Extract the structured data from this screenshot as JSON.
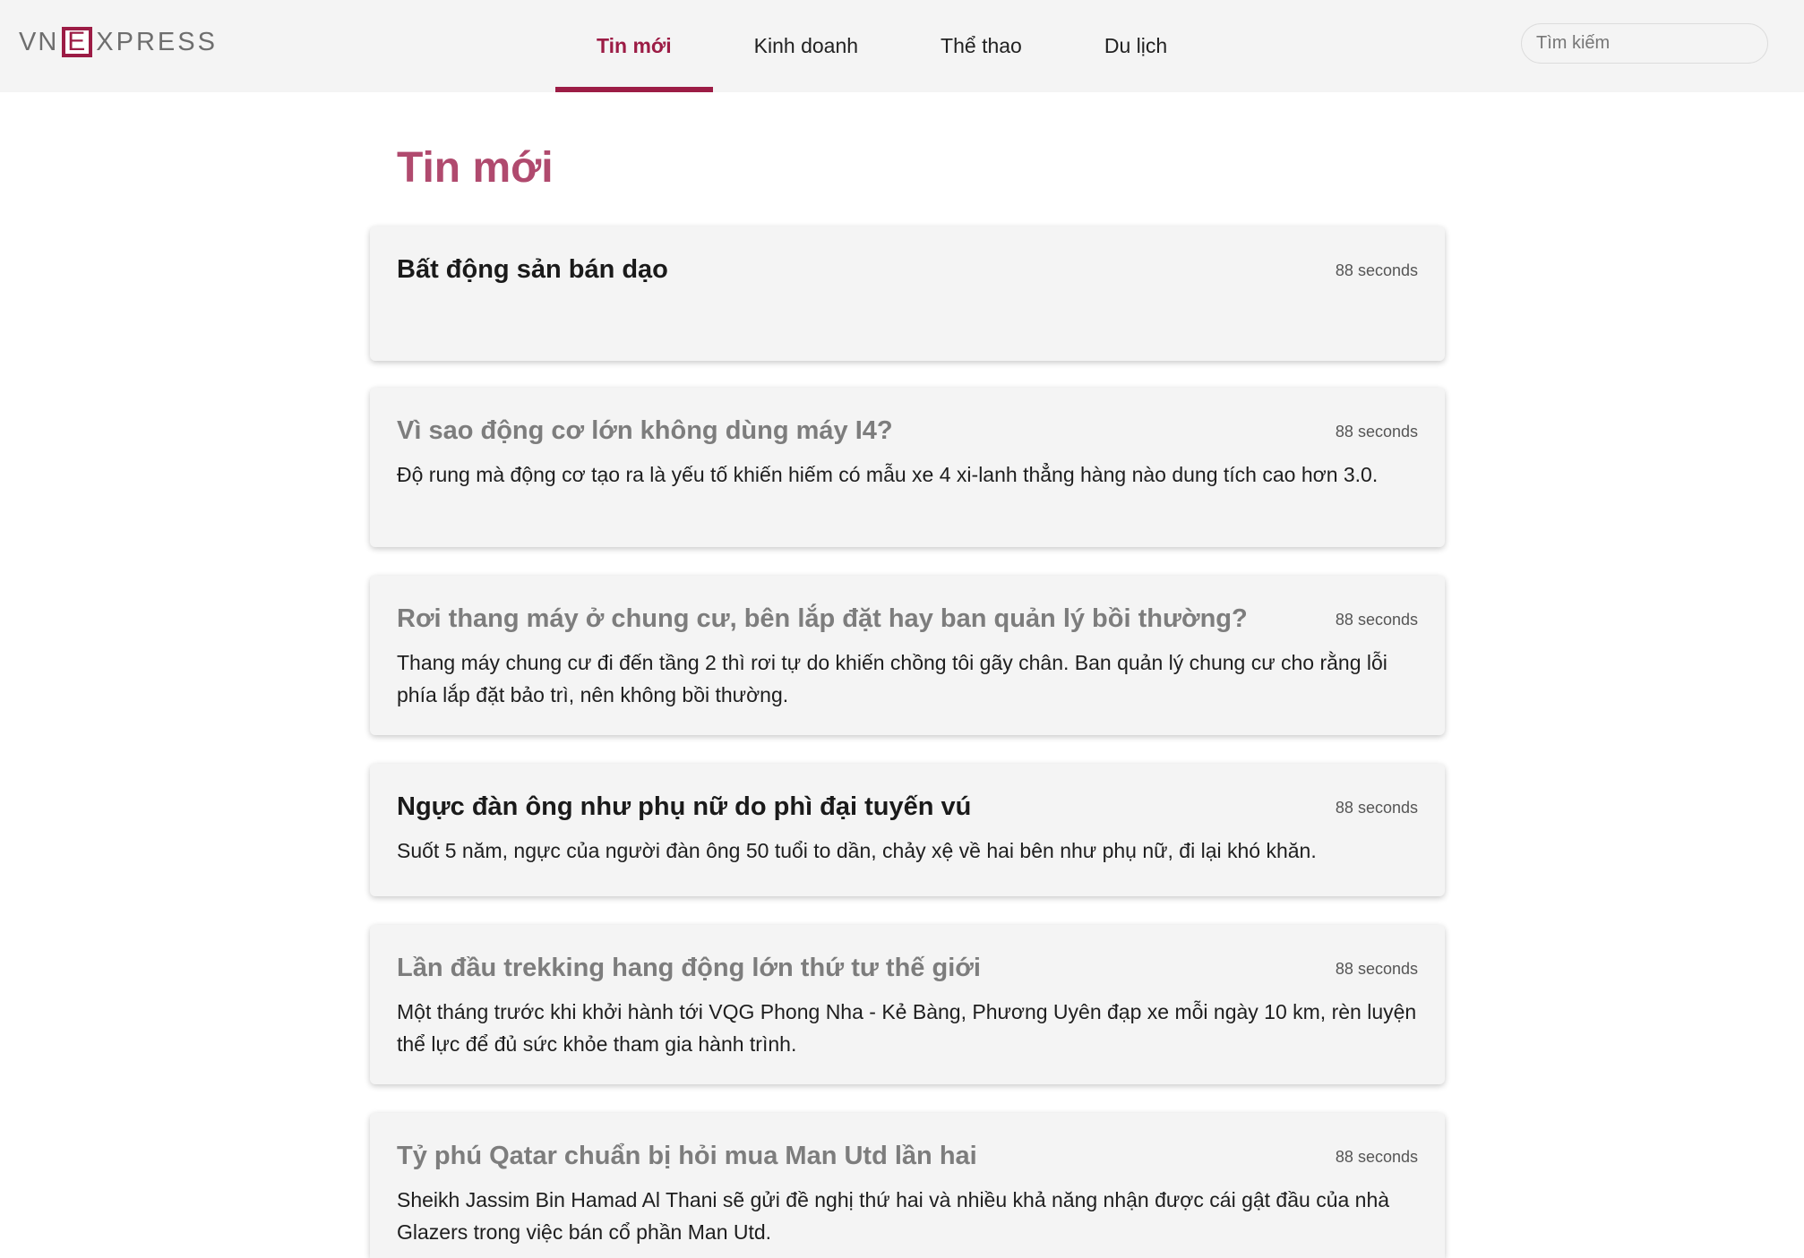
{
  "logo": {
    "vn": "VN",
    "e": "E",
    "xpress": "XPRESS"
  },
  "nav": {
    "items": [
      {
        "label": "Tin mới",
        "active": true
      },
      {
        "label": "Kinh doanh",
        "active": false
      },
      {
        "label": "Thể thao",
        "active": false
      },
      {
        "label": "Du lịch",
        "active": false
      }
    ]
  },
  "search": {
    "placeholder": "Tìm kiếm",
    "value": ""
  },
  "page": {
    "title": "Tin mới"
  },
  "articles": [
    {
      "title": "Bất động sản bán dạo",
      "time": "88 seconds",
      "description": "",
      "read": false
    },
    {
      "title": "Vì sao động cơ lớn không dùng máy I4?",
      "time": "88 seconds",
      "description": "Độ rung mà động cơ tạo ra là yếu tố khiến hiếm có mẫu xe 4 xi-lanh thẳng hàng nào dung tích cao hơn 3.0.",
      "read": true
    },
    {
      "title": "Rơi thang máy ở chung cư, bên lắp đặt hay ban quản lý bồi thường?",
      "time": "88 seconds",
      "description": "Thang máy chung cư đi đến tầng 2 thì rơi tự do khiến chồng tôi gãy chân. Ban quản lý chung cư cho rằng lỗi phía lắp đặt bảo trì, nên không bồi thường.",
      "read": true
    },
    {
      "title": "Ngực đàn ông như phụ nữ do phì đại tuyến vú",
      "time": "88 seconds",
      "description": "Suốt 5 năm, ngực của người đàn ông 50 tuổi to dần, chảy xệ về hai bên như phụ nữ, đi lại khó khăn.",
      "read": false
    },
    {
      "title": "Lần đầu trekking hang động lớn thứ tư thế giới",
      "time": "88 seconds",
      "description": "Một tháng trước khi khởi hành tới VQG Phong Nha - Kẻ Bàng, Phương Uyên đạp xe mỗi ngày 10 km, rèn luyện thể lực để đủ sức khỏe tham gia hành trình.",
      "read": true
    },
    {
      "title": "Tỷ phú Qatar chuẩn bị hỏi mua Man Utd lần hai",
      "time": "88 seconds",
      "description": "Sheikh Jassim Bin Hamad Al Thani sẽ gửi đề nghị thứ hai và nhiều khả năng nhận được cái gật đầu của nhà Glazers trong việc bán cổ phần Man Utd.",
      "read": true
    }
  ],
  "colors": {
    "accent": "#9c1c45",
    "title_accent": "#b04a6e",
    "card_bg": "#f4f4f4",
    "header_bg": "#f4f4f4",
    "read_title": "#7d7d7d"
  }
}
